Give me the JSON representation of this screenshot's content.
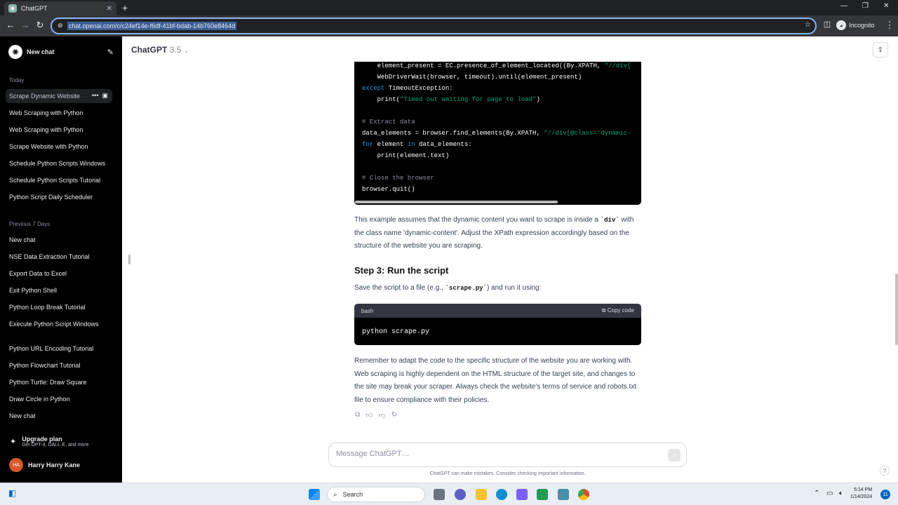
{
  "browser": {
    "tab_title": "ChatGPT",
    "tab_close": "✕",
    "url": "chat.openai.com/c/c24ef14e-f6df-41bf-bdab-14b760e8464d",
    "profile_label": "Incognito"
  },
  "sidebar": {
    "new_chat_label": "New chat",
    "section_today": "Today",
    "today_items": [
      {
        "label": "Scrape Dynamic Website"
      },
      {
        "label": "Web Scraping with Python"
      },
      {
        "label": "Web Scraping with Python"
      },
      {
        "label": "Scrape Website with Python"
      },
      {
        "label": "Schedule Python Scripts Windows"
      },
      {
        "label": "Schedule Python Scripts Tutorial"
      },
      {
        "label": "Python Script Daily Scheduler"
      }
    ],
    "section_prev7": "Previous 7 Days",
    "prev7_items": [
      {
        "label": "New chat"
      },
      {
        "label": "NSE Data Extraction Tutorial"
      },
      {
        "label": "Export Data to Excel"
      },
      {
        "label": "Exit Python Shell"
      },
      {
        "label": "Python Loop Break Tutorial"
      },
      {
        "label": "Execute Python Script Windows"
      },
      {
        "label": "Python URL Encoding Tutorial"
      },
      {
        "label": "Python Flowchart Tutorial"
      },
      {
        "label": "Python Turtle: Draw Square"
      },
      {
        "label": "Draw Circle in Python"
      },
      {
        "label": "New chat"
      }
    ],
    "upgrade_title": "Upgrade plan",
    "upgrade_subtitle": "Get GPT-4, DALL·E, and more",
    "user_initials": "HA",
    "user_name": "Harry Harry Kane"
  },
  "header": {
    "model_name": "ChatGPT",
    "model_version": "3.5"
  },
  "code_block_1": {
    "lines": [
      {
        "indent": "    ",
        "parts": [
          [
            "",
            "element_present = EC.presence_of_element_located((By.XPATH, "
          ],
          [
            "str",
            "\"//div["
          ]
        ]
      },
      {
        "indent": "    ",
        "parts": [
          [
            "",
            "WebDriverWait(browser, timeout).until(element_present)"
          ]
        ]
      },
      {
        "indent": "",
        "parts": [
          [
            "kw",
            "except"
          ],
          [
            "",
            " TimeoutException:"
          ]
        ]
      },
      {
        "indent": "    ",
        "parts": [
          [
            "",
            "print("
          ],
          [
            "str",
            "\"Timed out waiting for page to load\""
          ],
          [
            "",
            ")"
          ]
        ]
      },
      {
        "indent": "",
        "parts": []
      },
      {
        "indent": "",
        "parts": [
          [
            "com",
            "# Extract data"
          ]
        ]
      },
      {
        "indent": "",
        "parts": [
          [
            "",
            "data_elements = browser.find_elements(By.XPATH, "
          ],
          [
            "str",
            "\"//div[@class='dynamic-"
          ]
        ]
      },
      {
        "indent": "",
        "parts": [
          [
            "kw",
            "for"
          ],
          [
            "",
            " element "
          ],
          [
            "kw",
            "in"
          ],
          [
            "",
            " data_elements:"
          ]
        ]
      },
      {
        "indent": "    ",
        "parts": [
          [
            "",
            "print(element.text)"
          ]
        ]
      },
      {
        "indent": "",
        "parts": []
      },
      {
        "indent": "",
        "parts": [
          [
            "com",
            "# Close the browser"
          ]
        ]
      },
      {
        "indent": "",
        "parts": [
          [
            "",
            "browser.quit()"
          ]
        ]
      }
    ]
  },
  "response": {
    "para1_pre": "This example assumes that the dynamic content you want to scrape is inside a ",
    "para1_code": "`div`",
    "para1_post": " with the class name 'dynamic-content'. Adjust the XPath expression accordingly based on the structure of the website you are scraping.",
    "step3_heading": "Step 3: Run the script",
    "para2_pre": "Save the script to a file (e.g., ",
    "para2_code": "`scrape.py`",
    "para2_post": ") and run it using:",
    "code2_lang": "bash",
    "copy_label": "Copy code",
    "code2_text": "python scrape.py",
    "para3": "Remember to adapt the code to the specific structure of the website you are working with. Web scraping is highly dependent on the HTML structure of the target site, and changes to the site may break your scraper. Always check the website's terms of service and robots.txt file to ensure compliance with their policies."
  },
  "composer": {
    "placeholder": "Message ChatGPT…",
    "disclaimer": "ChatGPT can make mistakes. Consider checking important information.",
    "help": "?"
  },
  "taskbar": {
    "search_label": "Search",
    "time": "5:14 PM",
    "date": "1/14/2024",
    "notifications": "11"
  }
}
